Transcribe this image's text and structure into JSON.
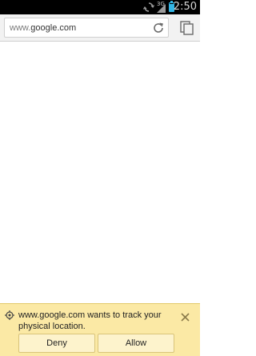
{
  "status_bar": {
    "time": "2:50",
    "network_type": "3G",
    "battery_level": 0.9,
    "battery_color": "#33b5e5"
  },
  "toolbar": {
    "url_prefix": "www.",
    "url_domain": "google.com",
    "reload_icon": "reload-icon",
    "tabs_icon": "tabs-icon"
  },
  "infobar": {
    "icon": "location-icon",
    "message": "www.google.com wants to track your physical location.",
    "deny_label": "Deny",
    "allow_label": "Allow",
    "background": "#fbe9a5"
  }
}
